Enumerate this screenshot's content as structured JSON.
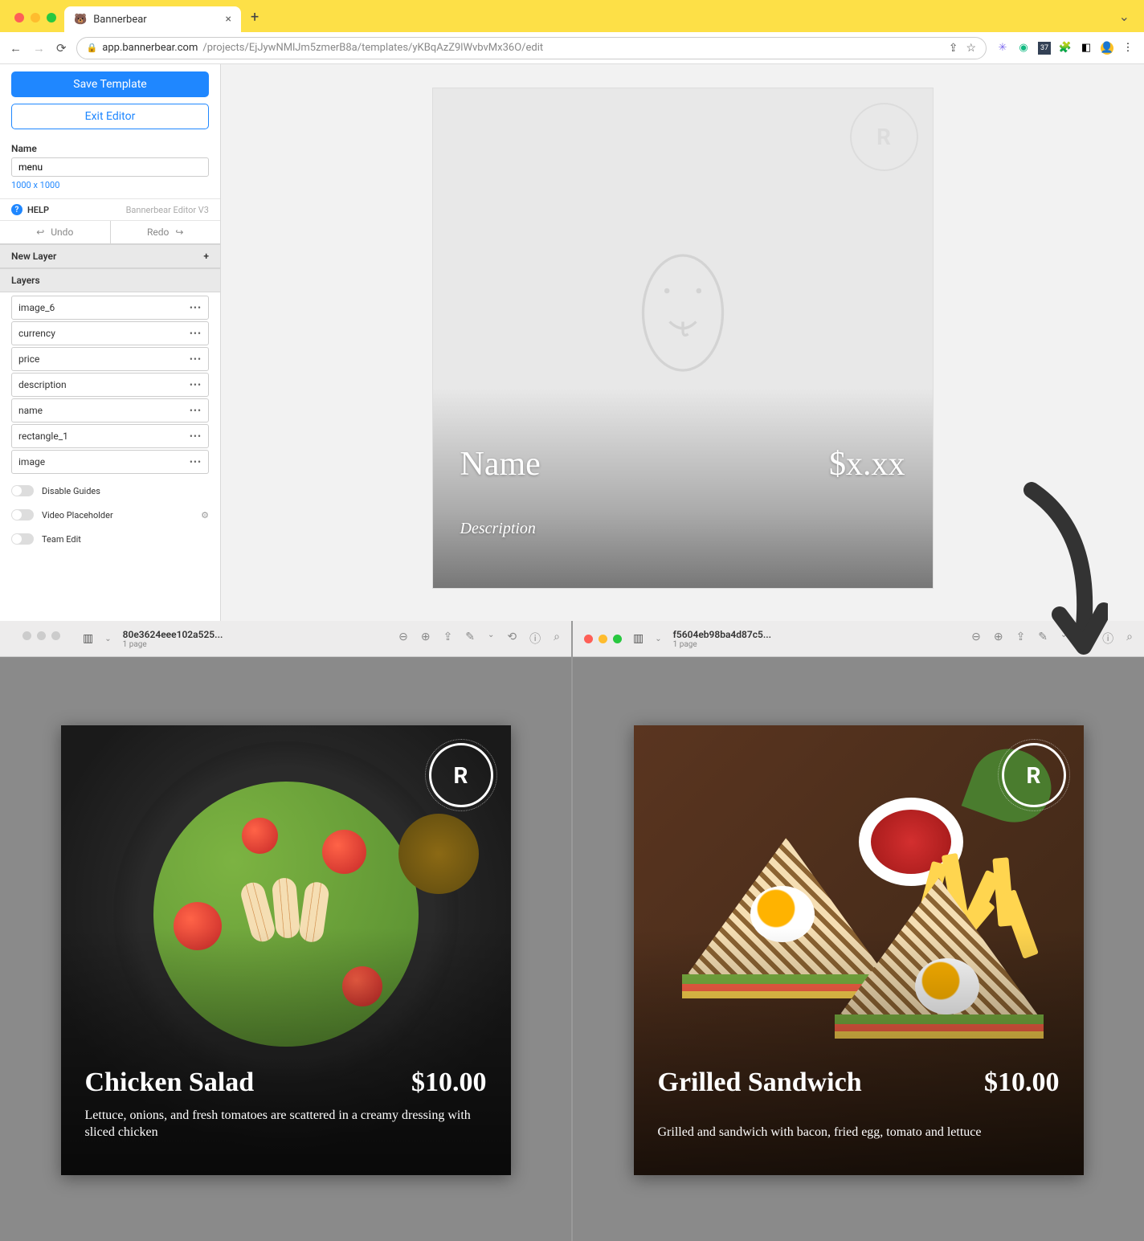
{
  "browser": {
    "tab_title": "Bannerbear",
    "url_host": "app.bannerbear.com",
    "url_path": "/projects/EjJywNMlJm5zmerB8a/templates/yKBqAzZ9lWvbvMx36O/edit"
  },
  "sidebar": {
    "save_label": "Save Template",
    "exit_label": "Exit Editor",
    "name_label": "Name",
    "name_value": "menu",
    "dimensions": "1000 x 1000",
    "help_label": "HELP",
    "editor_version": "Bannerbear Editor V3",
    "undo_label": "Undo",
    "redo_label": "Redo",
    "new_layer_label": "New Layer",
    "layers_label": "Layers",
    "layers": [
      {
        "label": "image_6"
      },
      {
        "label": "currency"
      },
      {
        "label": "price"
      },
      {
        "label": "description"
      },
      {
        "label": "name"
      },
      {
        "label": "rectangle_1"
      },
      {
        "label": "image"
      }
    ],
    "toggles": {
      "guides": "Disable Guides",
      "video": "Video Placeholder",
      "team": "Team Edit"
    }
  },
  "artboard": {
    "name": "Name",
    "price": "$x.xx",
    "description": "Description",
    "badge_letter": "R"
  },
  "previews": {
    "left": {
      "filename": "80e3624eee102a525...",
      "pages": "1 page",
      "card": {
        "name": "Chicken Salad",
        "price": "$10.00",
        "description": "Lettuce, onions, and fresh tomatoes are scattered in a creamy dressing with sliced chicken",
        "badge_letter": "R"
      }
    },
    "right": {
      "filename": "f5604eb98ba4d87c5...",
      "pages": "1 page",
      "card": {
        "name": "Grilled Sandwich",
        "price": "$10.00",
        "description": "Grilled and sandwich with bacon, fried egg, tomato and lettuce",
        "badge_letter": "R"
      }
    }
  }
}
